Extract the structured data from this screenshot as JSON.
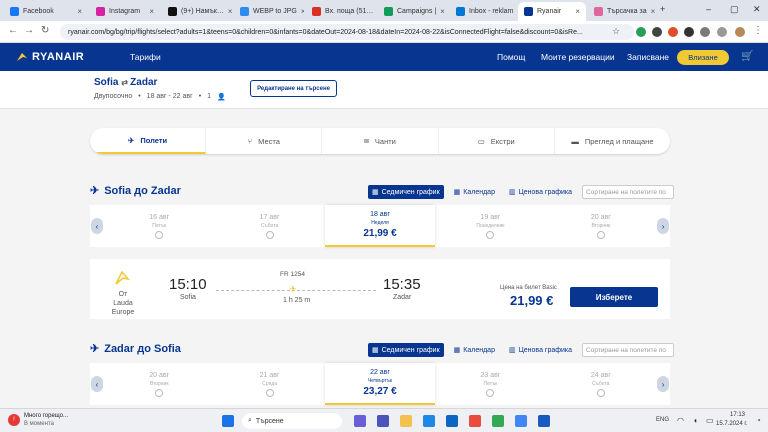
{
  "browser": {
    "tabs": [
      {
        "label": "Facebook",
        "color": "#1877f2"
      },
      {
        "label": "Instagram",
        "color": "#d6249f"
      },
      {
        "label": "(9+) Намък…",
        "color": "#111111"
      },
      {
        "label": "WEBP to JPG",
        "color": "#2d8cf0"
      },
      {
        "label": "Вх. поща (51…",
        "color": "#d93025"
      },
      {
        "label": "Campaigns |",
        "color": "#0f9d58"
      },
      {
        "label": "Inbox - reklam",
        "color": "#0078d4"
      },
      {
        "label": "Ryanair",
        "color": "#073590"
      },
      {
        "label": "Търсачка за",
        "color": "#e066a0"
      }
    ],
    "url": "ryanair.com/bg/bg/trip/flights/select?adults=1&teens=0&children=0&infants=0&dateOut=2024-08-18&dateIn=2024-08-22&isConnectedFlight=false&discount=0&isRe..."
  },
  "header": {
    "logo": "RYANAIR",
    "nav_fares": "Тарифи",
    "help": "Помощ",
    "my_bookings": "Моите резервации",
    "signup": "Записване",
    "login": "Влизане"
  },
  "trip": {
    "from": "Sofia",
    "to": "Zadar",
    "type": "Двупосочно",
    "dates": "18 авг - 22 авг",
    "passengers": "1",
    "edit": "Редактиране на търсене"
  },
  "steps": [
    "Полети",
    "Места",
    "Чанти",
    "Екстри",
    "Преглед и плащане"
  ],
  "toolbar": {
    "weekly": "Седмичен график",
    "calendar": "Календар",
    "price_chart": "Ценова графика",
    "sort_placeholder": "Сортиране на полетите по"
  },
  "outbound": {
    "title": "Sofia до Zadar",
    "days": [
      {
        "date": "16 авг",
        "weekday": "Петък"
      },
      {
        "date": "17 авг",
        "weekday": "Събота"
      },
      {
        "date": "18 авг",
        "weekday": "Неделя",
        "price": "21,99 €"
      },
      {
        "date": "19 авг",
        "weekday": "Понеделник"
      },
      {
        "date": "20 авг",
        "weekday": "Вторник"
      }
    ],
    "flight": {
      "operator": "От Lauda Europe",
      "depart_time": "15:10",
      "depart_city": "Sofia",
      "number": "FR 1254",
      "duration": "1 h 25 m",
      "arrive_time": "15:35",
      "arrive_city": "Zadar",
      "fare_label": "Цена на билет Basic",
      "price": "21,99 €",
      "select": "Изберете"
    }
  },
  "inbound": {
    "title": "Zadar до Sofia",
    "days": [
      {
        "date": "20 авг",
        "weekday": "Вторник"
      },
      {
        "date": "21 авг",
        "weekday": "Сряда"
      },
      {
        "date": "22 авг",
        "weekday": "Четвъртък",
        "price": "23,27 €"
      },
      {
        "date": "23 авг",
        "weekday": "Петък"
      },
      {
        "date": "24 авг",
        "weekday": "Събота"
      }
    ]
  },
  "taskbar": {
    "weather": "Много горещо...",
    "weather_sub": "В момента",
    "search": "Търсене",
    "lang": "ENG",
    "time": "17:13",
    "date": "15.7.2024 г."
  },
  "colors": {
    "brand": "#073590",
    "accent": "#f1c933"
  }
}
